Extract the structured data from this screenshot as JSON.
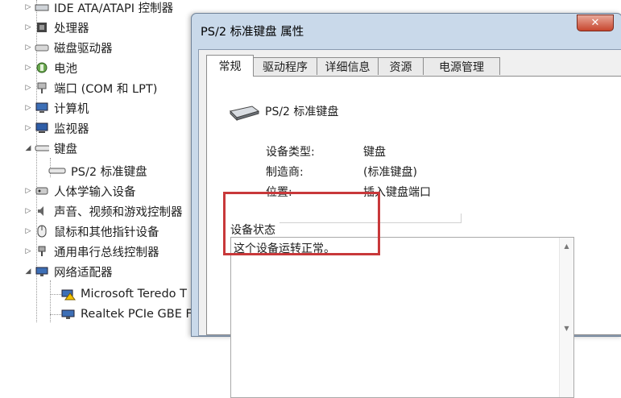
{
  "tree": {
    "items": [
      {
        "label": "IDE ATA/ATAPI 控制器",
        "icon": "ide-controller-icon",
        "expander": "▷"
      },
      {
        "label": "处理器",
        "icon": "processor-icon",
        "expander": "▷"
      },
      {
        "label": "磁盘驱动器",
        "icon": "disk-drive-icon",
        "expander": "▷"
      },
      {
        "label": "电池",
        "icon": "battery-icon",
        "expander": "▷"
      },
      {
        "label": "端口 (COM 和 LPT)",
        "icon": "port-icon",
        "expander": "▷"
      },
      {
        "label": "计算机",
        "icon": "computer-icon",
        "expander": "▷"
      },
      {
        "label": "监视器",
        "icon": "monitor-icon",
        "expander": "▷"
      },
      {
        "label": "键盘",
        "icon": "keyboard-icon",
        "expander": "◢"
      },
      {
        "label": "PS/2 标准键盘",
        "icon": "keyboard-device-icon",
        "expander": ""
      },
      {
        "label": "人体学输入设备",
        "icon": "hid-icon",
        "expander": "▷"
      },
      {
        "label": "声音、视频和游戏控制器",
        "icon": "sound-icon",
        "expander": "▷"
      },
      {
        "label": "鼠标和其他指针设备",
        "icon": "mouse-icon",
        "expander": "▷"
      },
      {
        "label": "通用串行总线控制器",
        "icon": "usb-icon",
        "expander": "▷"
      },
      {
        "label": "网络适配器",
        "icon": "network-adapter-icon",
        "expander": "◢"
      },
      {
        "label": "Microsoft Teredo T",
        "icon": "warning-network-icon",
        "expander": ""
      },
      {
        "label": "Realtek PCIe GBE F",
        "icon": "network-card-icon",
        "expander": ""
      }
    ]
  },
  "window": {
    "title": "PS/2 标准键盘 属性",
    "close_glyph": "✕",
    "tabs": [
      {
        "label": "常规"
      },
      {
        "label": "驱动程序"
      },
      {
        "label": "详细信息"
      },
      {
        "label": "资源"
      },
      {
        "label": "电源管理"
      }
    ],
    "device_name": "PS/2 标准键盘",
    "fields": {
      "type_label": "设备类型:",
      "type_value": "键盘",
      "maker_label": "制造商:",
      "maker_value": "(标准键盘)",
      "location_label": "位置:",
      "location_value": "插入键盘端口"
    },
    "status_group_label": "设备状态",
    "status_text": "这个设备运转正常。",
    "scroll_up": "▲",
    "scroll_down": "▼"
  },
  "colors": {
    "highlight": "#c8383a",
    "title_bar": "#c9d9ea",
    "close_button": "#c7462e"
  }
}
